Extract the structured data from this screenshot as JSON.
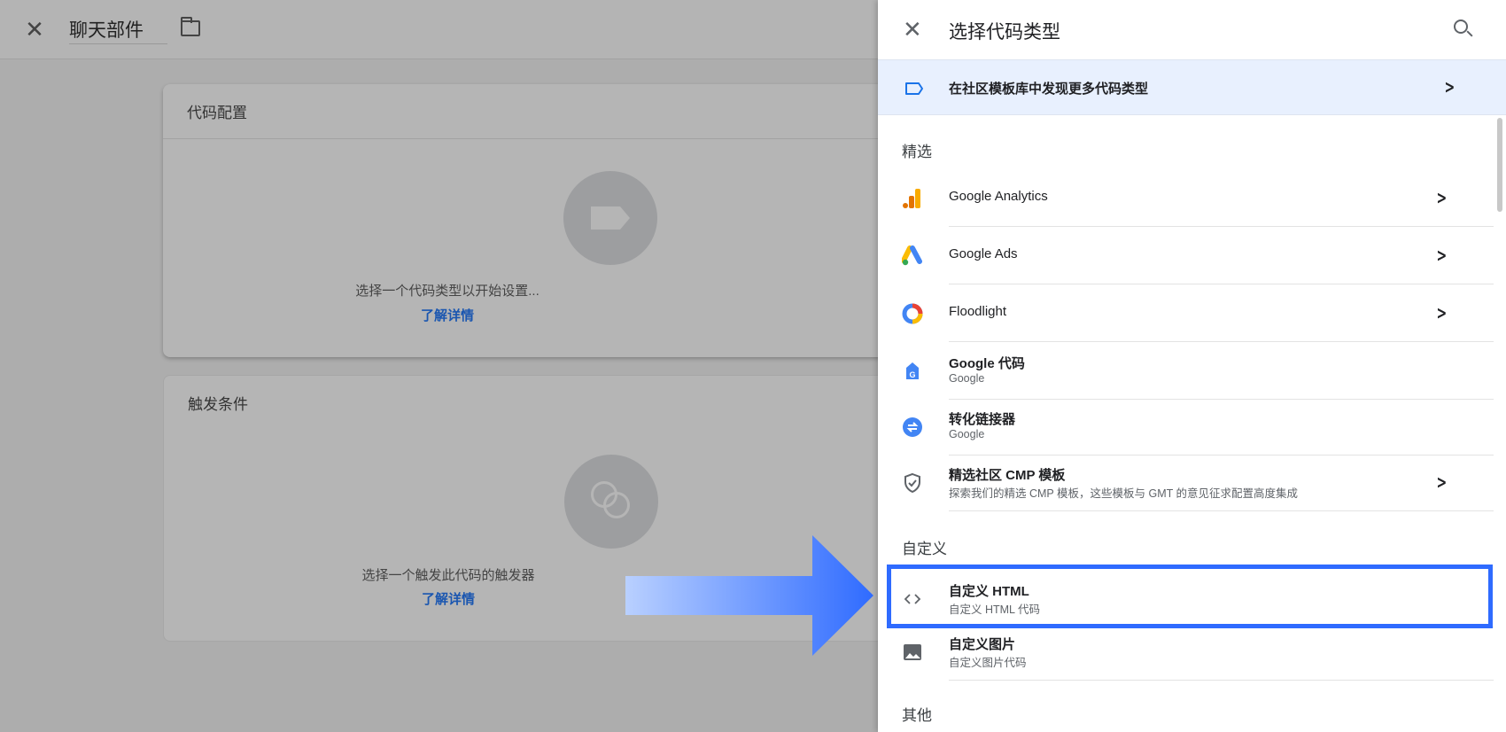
{
  "topbar": {
    "title": "聊天部件",
    "close_icon": "close-icon",
    "folder_icon": "folder-icon"
  },
  "cards": [
    {
      "title": "代码配置",
      "message": "选择一个代码类型以开始设置...",
      "link": "了解详情"
    },
    {
      "title": "触发条件",
      "message": "选择一个触发此代码的触发器",
      "link": "了解详情"
    }
  ],
  "panel": {
    "title": "选择代码类型",
    "banner": "在社区模板库中发现更多代码类型",
    "sections": {
      "featured": "精选",
      "custom": "自定义",
      "other": "其他"
    },
    "featured": [
      {
        "name": "Google Analytics"
      },
      {
        "name": "Google Ads"
      },
      {
        "name": "Floodlight"
      },
      {
        "name": "Google 代码",
        "sub": "Google"
      },
      {
        "name": "转化链接器",
        "sub": "Google"
      },
      {
        "name": "精选社区 CMP 模板",
        "sub": "探索我们的精选 CMP 模板，这些模板与 GMT 的意见征求配置高度集成"
      }
    ],
    "custom": [
      {
        "name": "自定义 HTML",
        "sub": "自定义 HTML 代码"
      },
      {
        "name": "自定义图片",
        "sub": "自定义图片代码"
      }
    ]
  },
  "colors": {
    "highlight": "#2f6bff",
    "link": "#1a56b0",
    "banner_bg": "#e8f0fe"
  }
}
